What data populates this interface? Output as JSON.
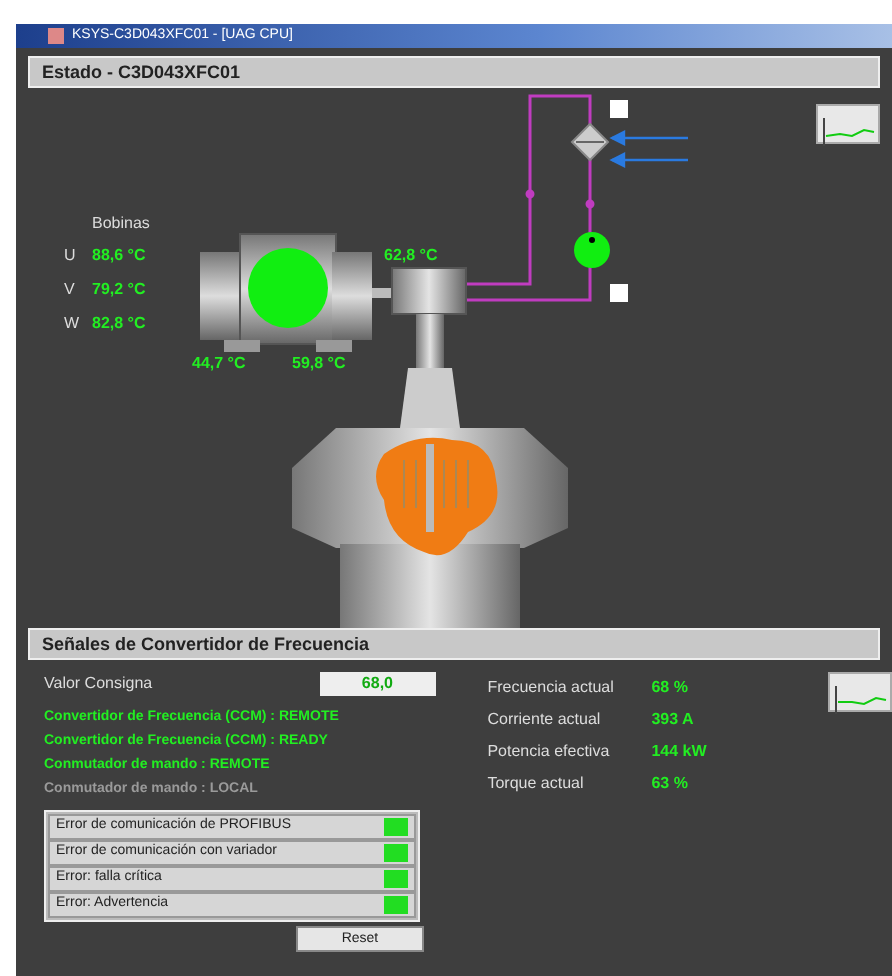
{
  "window": {
    "title": "KSYS-C3D043XFC01 - [UAG CPU]"
  },
  "status_panel": {
    "title": "Estado - C3D043XFC01",
    "windings_label": "Bobinas",
    "windings": [
      {
        "phase": "U",
        "reading": "88,6 °C"
      },
      {
        "phase": "V",
        "reading": "79,2 °C"
      },
      {
        "phase": "W",
        "reading": "82,8 °C"
      }
    ],
    "bearing_readings": [
      "44,7 °C",
      "59,8 °C"
    ],
    "coupling_reading": "62,8 °C"
  },
  "converter_panel": {
    "title": "Señales de Convertidor de Frecuencia",
    "setpoint": {
      "label": "Valor Consigna",
      "value": "68,0"
    },
    "signals": [
      {
        "text": "Convertidor de Frecuencia (CCM) : REMOTE",
        "active": true
      },
      {
        "text": "Convertidor de Frecuencia (CCM) : READY",
        "active": true
      },
      {
        "text": "Conmutador de mando : REMOTE",
        "active": true
      },
      {
        "text": "Conmutador de mando : LOCAL",
        "active": false
      }
    ],
    "measurements": [
      {
        "label": "Frecuencia actual",
        "value": "68 %"
      },
      {
        "label": "Corriente actual",
        "value": "393 A"
      },
      {
        "label": "Potencia efectiva",
        "value": "144 kW"
      },
      {
        "label": "Torque actual",
        "value": "63 %"
      }
    ],
    "errors": [
      {
        "label": "Error de comunicación de PROFIBUS",
        "color": "#22dd22"
      },
      {
        "label": "Error de comunicación con variador",
        "color": "#22dd22"
      },
      {
        "label": "Error: falla crítica",
        "color": "#22dd22"
      },
      {
        "label": "Error: Advertencia",
        "color": "#22dd22"
      }
    ],
    "reset_button": "Reset"
  }
}
